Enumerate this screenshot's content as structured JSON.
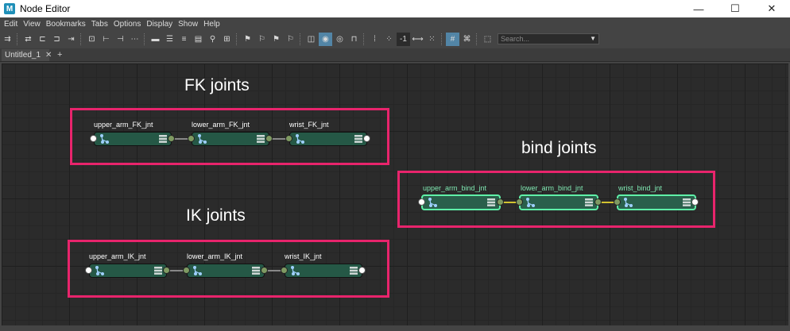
{
  "window": {
    "title": "Node Editor",
    "controls": [
      "—",
      "☐",
      "✕"
    ]
  },
  "menus": [
    "Edit",
    "View",
    "Bookmarks",
    "Tabs",
    "Options",
    "Display",
    "Show",
    "Help"
  ],
  "toolbar": {
    "negative_label": "-1",
    "search_placeholder": "Search..."
  },
  "tabs": [
    {
      "label": "Untitled_1",
      "close": "✕"
    }
  ],
  "tab_add": "+",
  "groups": {
    "fk": {
      "label": "FK joints",
      "nodes": [
        "upper_arm_FK_jnt",
        "lower_arm_FK_jnt",
        "wrist_FK_jnt"
      ]
    },
    "ik": {
      "label": "IK joints",
      "nodes": [
        "upper_arm_IK_jnt",
        "lower_arm_IK_jnt",
        "wrist_IK_jnt"
      ]
    },
    "bind": {
      "label": "bind joints",
      "nodes": [
        "upper_arm_bind_jnt",
        "lower_arm_bind_jnt",
        "wrist_bind_jnt"
      ]
    }
  },
  "colors": {
    "highlight_box": "#e8246c",
    "node_fill": "#255846",
    "bind_outline": "#5ff0a8",
    "bind_wire": "#d2c330"
  }
}
